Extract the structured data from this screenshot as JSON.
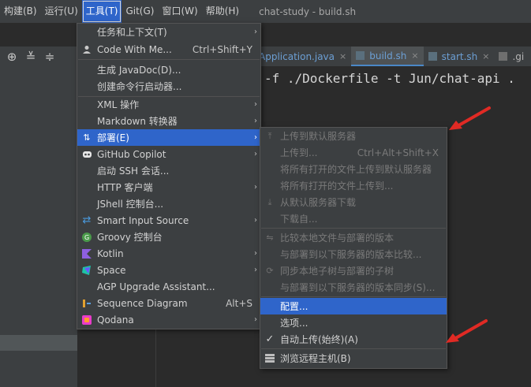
{
  "menubar": {
    "items": [
      {
        "label": "构建(B)",
        "active": false
      },
      {
        "label": "运行(U)",
        "active": false
      },
      {
        "label": "工具(T)",
        "active": true
      },
      {
        "label": "Git(G)",
        "active": false
      },
      {
        "label": "窗口(W)",
        "active": false
      },
      {
        "label": "帮助(H)",
        "active": false
      }
    ],
    "window_title": "chat-study - build.sh"
  },
  "tabs": [
    {
      "label": "Application.java",
      "active": false,
      "close": "×"
    },
    {
      "label": "build.sh",
      "active": true,
      "close": "×"
    },
    {
      "label": "start.sh",
      "active": false,
      "close": "×"
    },
    {
      "label": ".gi",
      "active": false,
      "close": ""
    }
  ],
  "code_line": "-f ./Dockerfile -t Jun/chat-api .",
  "tools_menu": [
    {
      "label": "任务和上下文(T)",
      "shortcut": "",
      "arrow": "›",
      "icon": ""
    },
    {
      "label": "Code With Me...",
      "shortcut": "Ctrl+Shift+Y",
      "arrow": "",
      "icon": "user-icon"
    },
    {
      "sep": true
    },
    {
      "label": "生成 JavaDoc(D)...",
      "shortcut": "",
      "arrow": "",
      "icon": ""
    },
    {
      "label": "创建命令行启动器...",
      "shortcut": "",
      "arrow": "",
      "icon": ""
    },
    {
      "sep": true
    },
    {
      "label": "XML 操作",
      "shortcut": "",
      "arrow": "›",
      "icon": ""
    },
    {
      "label": "Markdown 转换器",
      "shortcut": "",
      "arrow": "›",
      "icon": ""
    },
    {
      "label": "部署(E)",
      "shortcut": "",
      "arrow": "›",
      "icon": "deploy-icon",
      "selected": true
    },
    {
      "label": "GitHub Copilot",
      "shortcut": "",
      "arrow": "›",
      "icon": "copilot-icon"
    },
    {
      "label": "启动 SSH 会话...",
      "shortcut": "",
      "arrow": "",
      "icon": ""
    },
    {
      "label": "HTTP 客户端",
      "shortcut": "",
      "arrow": "›",
      "icon": ""
    },
    {
      "label": "JShell 控制台...",
      "shortcut": "",
      "arrow": "",
      "icon": ""
    },
    {
      "label": "Smart Input Source",
      "shortcut": "",
      "arrow": "›",
      "icon": "swap-icon"
    },
    {
      "label": "Groovy 控制台",
      "shortcut": "",
      "arrow": "",
      "icon": "groovy-icon"
    },
    {
      "label": "Kotlin",
      "shortcut": "",
      "arrow": "›",
      "icon": "kotlin-icon"
    },
    {
      "label": "Space",
      "shortcut": "",
      "arrow": "›",
      "icon": "space-icon"
    },
    {
      "label": "AGP Upgrade Assistant...",
      "shortcut": "",
      "arrow": "",
      "icon": ""
    },
    {
      "label": "Sequence Diagram",
      "shortcut": "Alt+S",
      "arrow": "",
      "icon": "sequence-icon"
    },
    {
      "label": "Qodana",
      "shortcut": "",
      "arrow": "›",
      "icon": "qodana-icon"
    }
  ],
  "deploy_menu": [
    {
      "label": "上传到默认服务器",
      "shortcut": "",
      "disabled": true,
      "icon": "upload-icon"
    },
    {
      "label": "上传到...",
      "shortcut": "Ctrl+Alt+Shift+X",
      "disabled": true,
      "icon": ""
    },
    {
      "label": "将所有打开的文件上传到默认服务器",
      "shortcut": "",
      "disabled": true,
      "icon": ""
    },
    {
      "label": "将所有打开的文件上传到...",
      "shortcut": "",
      "disabled": true,
      "icon": ""
    },
    {
      "label": "从默认服务器下载",
      "shortcut": "",
      "disabled": true,
      "icon": "download-icon"
    },
    {
      "label": "下载自...",
      "shortcut": "",
      "disabled": true,
      "icon": ""
    },
    {
      "sep": true
    },
    {
      "label": "比较本地文件与部署的版本",
      "shortcut": "",
      "disabled": true,
      "icon": "compare-icon"
    },
    {
      "label": "与部署到以下服务器的版本比较...",
      "shortcut": "",
      "disabled": true,
      "icon": ""
    },
    {
      "label": "同步本地子树与部署的子树",
      "shortcut": "",
      "disabled": true,
      "icon": "sync-icon"
    },
    {
      "label": "与部署到以下服务器的版本同步(S)...",
      "shortcut": "",
      "disabled": true,
      "icon": ""
    },
    {
      "sep": true
    },
    {
      "label": "配置...",
      "shortcut": "",
      "disabled": false,
      "selected": true,
      "icon": ""
    },
    {
      "label": "选项...",
      "shortcut": "",
      "disabled": false,
      "icon": ""
    },
    {
      "label": "自动上传(始终)(A)",
      "shortcut": "",
      "disabled": false,
      "icon": "check-icon"
    },
    {
      "sep": true
    },
    {
      "label": "浏览远程主机(B)",
      "shortcut": "",
      "disabled": false,
      "icon": "remote-host-icon"
    }
  ],
  "colors": {
    "accent": "#2f65ca",
    "arrow": "#e02a24"
  }
}
